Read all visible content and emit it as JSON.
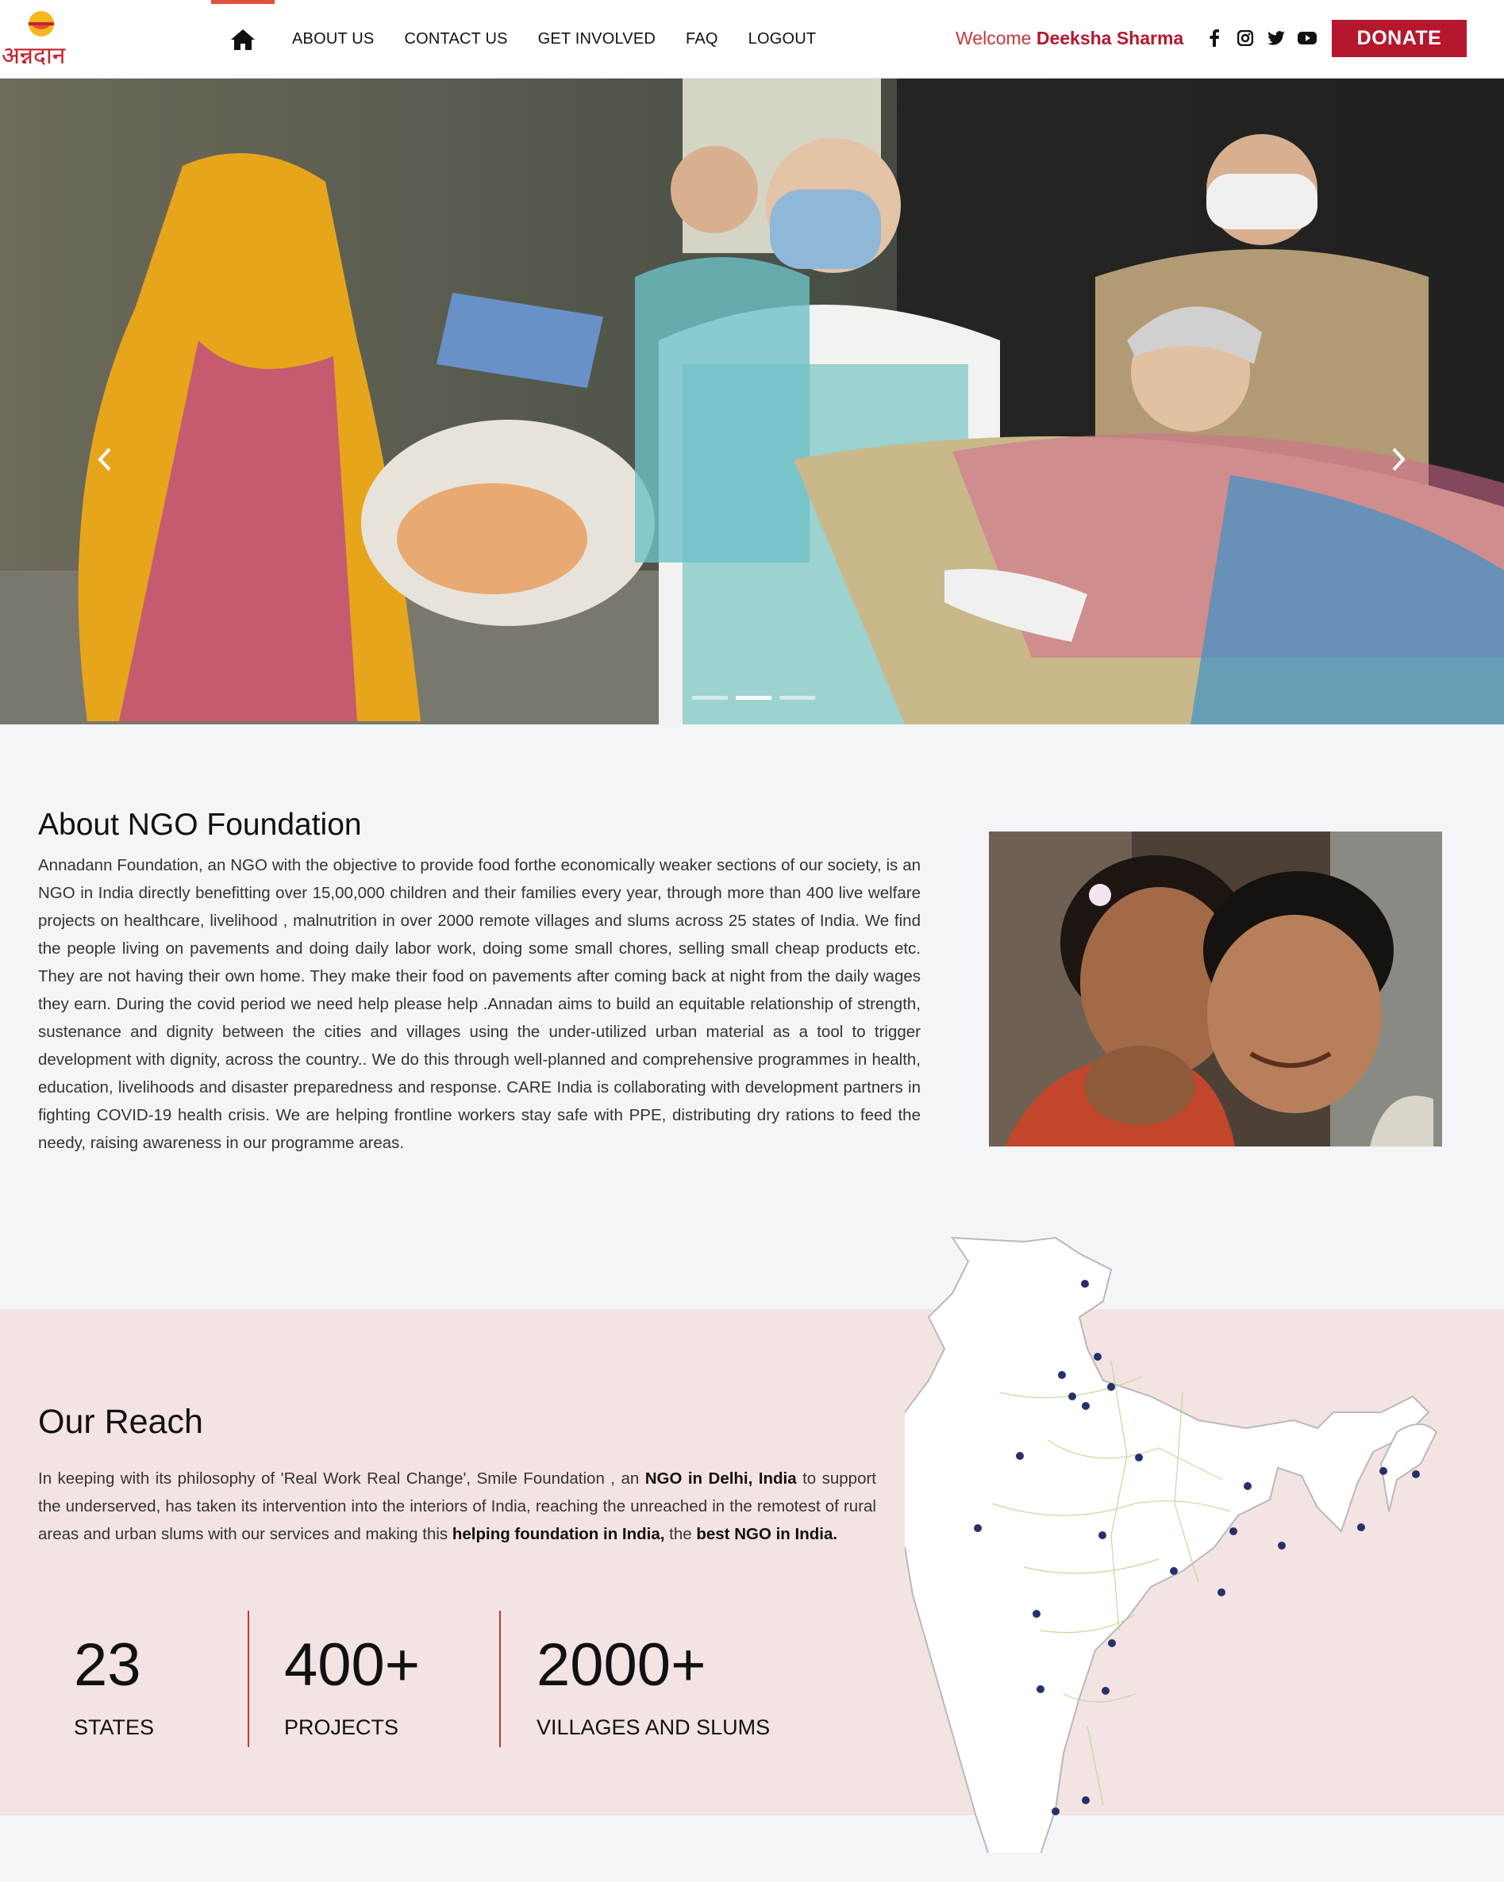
{
  "nav": {
    "home_icon": "home-icon",
    "items": [
      "ABOUT US",
      "CONTACT US",
      "GET INVOLVED",
      "FAQ",
      "LOGOUT"
    ]
  },
  "header": {
    "logo_text": "अन्नदान",
    "welcome_label": "Welcome",
    "user_name": "Deeksha Sharma",
    "socials": [
      "facebook-icon",
      "instagram-icon",
      "twitter-icon",
      "youtube-icon"
    ],
    "donate_label": "DONATE"
  },
  "hero": {
    "slide_count": 3,
    "active_slide": 2
  },
  "about": {
    "title": "About NGO Foundation",
    "text": "Annadann Foundation, an NGO with the objective to provide food forthe economically weaker sections of our society, is an NGO in India directly benefitting over 15,00,000 children and their families every year, through more than 400 live welfare projects on healthcare, livelihood , malnutrition in over 2000 remote villages and slums across 25 states of India. We find the people living on pavements and doing daily labor work, doing some small chores, selling small cheap products etc. They are not having their own home. They make their food on pavements after coming back at night from the daily wages they earn. During the covid period we need help please help .Annadan aims to build an equitable relationship of strength, sustenance and dignity between the cities and villages using the under-utilized urban material as a tool to trigger development with dignity, across the country.. We do this through well-planned and comprehensive programmes in health, education, livelihoods and disaster preparedness and response. CARE India is collaborating with development partners in fighting COVID-19 health crisis. We are helping frontline workers stay safe with PPE, distributing dry rations to feed the needy, raising awareness in our programme areas."
  },
  "reach": {
    "title": "Our Reach",
    "text_1": "In keeping with its philosophy of 'Real Work Real Change', Smile Foundation , an ",
    "bold_1": "NGO in Delhi, India",
    "text_2": " to support the underserved, has taken its intervention into the interiors of India, reaching the unreached in the remotest of rural areas and urban slums with our services and making this ",
    "bold_2": "helping foundation in India,",
    "text_3": " the ",
    "bold_3": "best NGO in India.",
    "stats": [
      {
        "value": "23",
        "label": "STATES"
      },
      {
        "value": "400+",
        "label": "PROJECTS"
      },
      {
        "value": "2000+",
        "label": "VILLAGES AND SLUMS"
      }
    ]
  },
  "colors": {
    "brand": "#b5172e",
    "accent": "#e0513b",
    "reach_bg": "#f4e3e3",
    "page_bg": "#f4f5f9",
    "map_dot": "#27306b"
  }
}
